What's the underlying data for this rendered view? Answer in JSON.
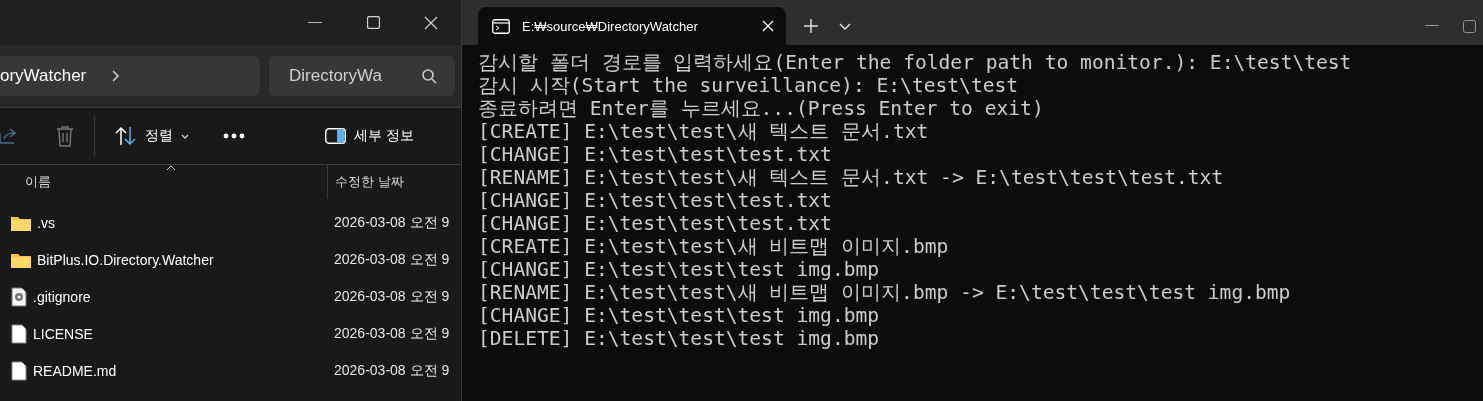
{
  "explorer": {
    "address": "oryWatcher",
    "search": {
      "value": "DirectoryWa"
    },
    "toolbar": {
      "sort": "정렬",
      "details": "세부 정보"
    },
    "columns": [
      "이름",
      "수정한 날짜"
    ],
    "files": [
      {
        "kind": "folder",
        "name": ".vs",
        "date": "2026-03-08 오전 9"
      },
      {
        "kind": "folder",
        "name": "BitPlus.IO.Directory.Watcher",
        "date": "2026-03-08 오전 9"
      },
      {
        "kind": "config",
        "name": ".gitignore",
        "date": "2026-03-08 오전 9"
      },
      {
        "kind": "file",
        "name": "LICENSE",
        "date": "2026-03-08 오전 9"
      },
      {
        "kind": "file",
        "name": "README.md",
        "date": "2026-03-08 오전 9"
      }
    ]
  },
  "terminal": {
    "tab": {
      "title": "E:₩source₩DirectoryWatcher",
      "selected": true
    },
    "lines": [
      "감시할 폴더 경로를 입력하세요(Enter the folder path to monitor.): E:\\test\\test",
      "감시 시작(Start the surveillance): E:\\test\\test",
      "종료하려면 Enter를 누르세요...(Press Enter to exit)",
      "[CREATE] E:\\test\\test\\새 텍스트 문서.txt",
      "[CHANGE] E:\\test\\test\\test.txt",
      "[RENAME] E:\\test\\test\\새 텍스트 문서.txt -> E:\\test\\test\\test.txt",
      "[CHANGE] E:\\test\\test\\test.txt",
      "[CHANGE] E:\\test\\test\\test.txt",
      "[CREATE] E:\\test\\test\\새 비트맵 이미지.bmp",
      "[CHANGE] E:\\test\\test\\test img.bmp",
      "[RENAME] E:\\test\\test\\새 비트맵 이미지.bmp -> E:\\test\\test\\test img.bmp",
      "[CHANGE] E:\\test\\test\\test img.bmp",
      "[DELETE] E:\\test\\test\\test img.bmp"
    ]
  }
}
